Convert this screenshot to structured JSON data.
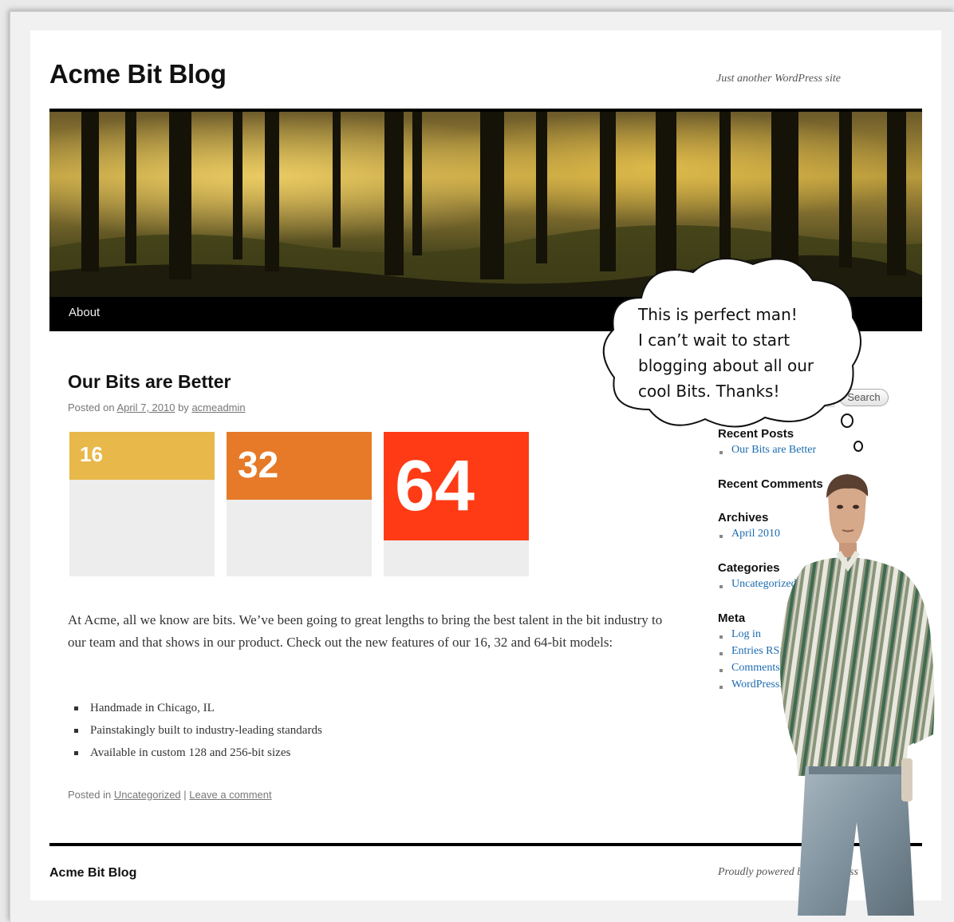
{
  "site": {
    "title": "Acme Bit Blog",
    "description": "Just another WordPress site"
  },
  "nav": {
    "items": [
      {
        "label": "About"
      }
    ]
  },
  "post": {
    "title": "Our Bits are Better",
    "meta": {
      "prefix": "Posted on",
      "date": "April 7, 2010",
      "by": "by",
      "author": "acmeadmin"
    },
    "bits": [
      {
        "label": "16",
        "color": "#e8b84a",
        "fill_fraction": 0.33
      },
      {
        "label": "32",
        "color": "#e67a28",
        "fill_fraction": 0.47
      },
      {
        "label": "64",
        "color": "#fe3b15",
        "fill_fraction": 0.75
      }
    ],
    "body": "At Acme, all we know are bits. We’ve been going to great lengths to bring the best talent in the bit industry to our team and that shows in our product. Check out the new features of our 16, 32 and 64-bit models:",
    "features": [
      "Handmade in Chicago, IL",
      "Painstakingly built to industry-leading standards",
      "Available in custom 128 and 256-bit sizes"
    ],
    "footer": {
      "prefix": "Posted in",
      "category": "Uncategorized",
      "separator": "|",
      "comment_link": "Leave a comment"
    }
  },
  "sidebar": {
    "search_button": "Search",
    "recent_posts": {
      "title": "Recent Posts",
      "items": [
        "Our Bits are Better"
      ]
    },
    "recent_comments": {
      "title": "Recent Comments"
    },
    "archives": {
      "title": "Archives",
      "items": [
        "April 2010"
      ]
    },
    "categories": {
      "title": "Categories",
      "items": [
        "Uncategorized"
      ]
    },
    "meta": {
      "title": "Meta",
      "items": [
        "Log in",
        "Entries RSS",
        "Comments RSS",
        "WordPress.org"
      ]
    }
  },
  "footer": {
    "site_title": "Acme Bit Blog",
    "powered": "Proudly powered by WordPress"
  },
  "thought_bubble": {
    "lines": [
      "This is perfect man!",
      "I can’t wait to start",
      "blogging about all our",
      "cool Bits. Thanks!"
    ]
  },
  "colors": {
    "link": "#1b6bb0",
    "nav_bar": "#000000",
    "text": "#333333"
  }
}
